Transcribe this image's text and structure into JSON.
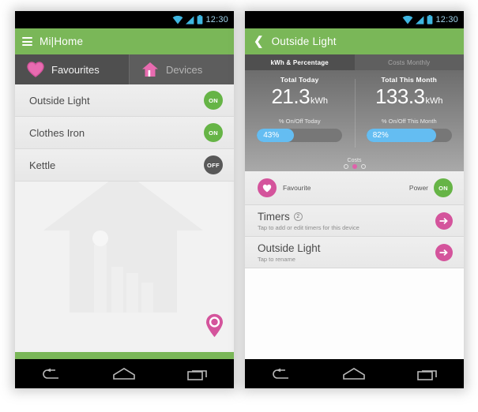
{
  "status_bar": {
    "time": "12:30",
    "icons": [
      "wifi-icon",
      "signal-icon",
      "battery-icon"
    ]
  },
  "colors": {
    "green": "#7ab758",
    "pink": "#d4549c",
    "blue": "#64bdf2",
    "toggle_on": "#66b446",
    "toggle_off": "#585858"
  },
  "left_phone": {
    "action_bar": {
      "menu_icon": "hamburger-icon",
      "title": "Mi|Home"
    },
    "tabs": [
      {
        "label": "Favourites",
        "icon": "heart-icon",
        "active": true
      },
      {
        "label": "Devices",
        "icon": "house-icon",
        "active": false
      }
    ],
    "devices": [
      {
        "name": "Outside Light",
        "state": "ON"
      },
      {
        "name": "Clothes Iron",
        "state": "ON"
      },
      {
        "name": "Kettle",
        "state": "OFF"
      }
    ],
    "fab": {
      "icon": "location-pin-icon"
    },
    "nav_bar": [
      "back-icon",
      "home-icon",
      "recents-icon"
    ]
  },
  "right_phone": {
    "action_bar": {
      "back_icon": "back-chevron-icon",
      "title": "Outside Light"
    },
    "tabs": [
      {
        "label": "kWh & Percentage",
        "active": true
      },
      {
        "label": "Costs Monthly",
        "active": false
      }
    ],
    "stats": [
      {
        "title": "Total Today",
        "value": "21.3",
        "unit": "kWh",
        "sub": "% On/Off Today",
        "percent_label": "43%",
        "percent": 43
      },
      {
        "title": "Total This Month",
        "value": "133.3",
        "unit": "kWh",
        "sub": "% On/Off This Month",
        "percent_label": "82%",
        "percent": 82
      }
    ],
    "pager": {
      "label": "Costs",
      "total": 3,
      "active_index": 1
    },
    "favourite_row": {
      "icon": "heart-icon",
      "label": "Favourite",
      "power_label": "Power",
      "power_state": "ON"
    },
    "nav_rows": [
      {
        "title": "Timers",
        "count": "2",
        "sub": "Tap to add or edit timers for this device",
        "arrow": "arrow-right-icon"
      },
      {
        "title": "Outside Light",
        "count": "",
        "sub": "Tap to rename",
        "arrow": "arrow-right-icon"
      }
    ],
    "nav_bar": [
      "back-icon",
      "home-icon",
      "recents-icon"
    ]
  }
}
